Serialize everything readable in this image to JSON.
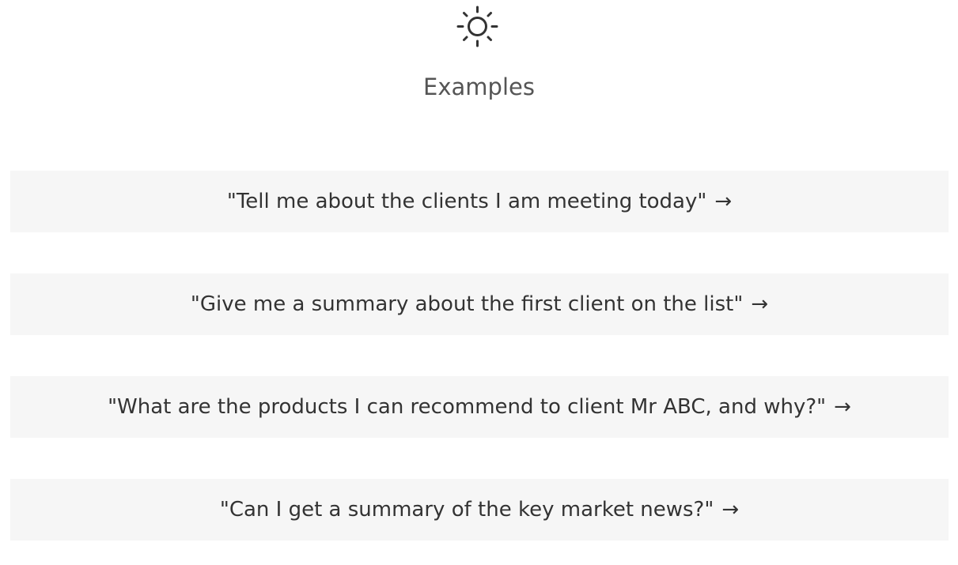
{
  "header": {
    "icon": "sun-icon",
    "title": "Examples"
  },
  "examples": [
    {
      "text": "\"Tell me about the clients I am meeting today\"",
      "arrow": "→"
    },
    {
      "text": "\"Give me a summary about the first client on the list\"",
      "arrow": "→"
    },
    {
      "text": "\"What are the products I can recommend to client Mr ABC, and why?\"",
      "arrow": "→"
    },
    {
      "text": "\"Can I get a summary of the key market news?\"",
      "arrow": "→"
    }
  ]
}
